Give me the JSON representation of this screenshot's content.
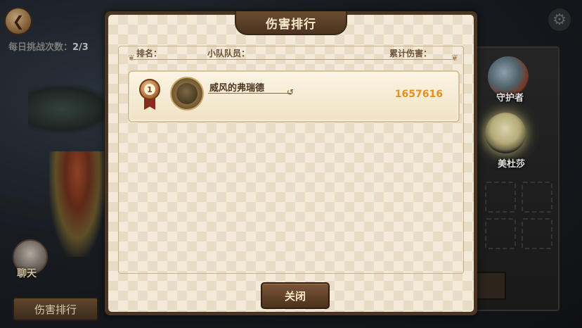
{
  "background": {
    "daily_label": "每日挑战次数：",
    "daily_count": "2/3",
    "chat_label": "聊天",
    "rank_button_label": "伤害排行",
    "back_icon": "back-arrow-icon",
    "settings_icon": "gear-icon",
    "characters": [
      {
        "label": "守护者"
      },
      {
        "label": "美杜莎"
      }
    ]
  },
  "modal": {
    "title": "伤害排行",
    "headers": {
      "rank": "排名：",
      "member": "小队队员：",
      "damage": "累计伤害："
    },
    "entries": [
      {
        "rank": "1",
        "name": "威风的弗瑞德",
        "damage": "1657616"
      }
    ],
    "close_label": "关闭"
  },
  "colors": {
    "damage_text": "#e19122",
    "panel_bg": "#f3ead9",
    "frame_brown": "#4a3522",
    "medal_bronze": "#b36d3a"
  }
}
